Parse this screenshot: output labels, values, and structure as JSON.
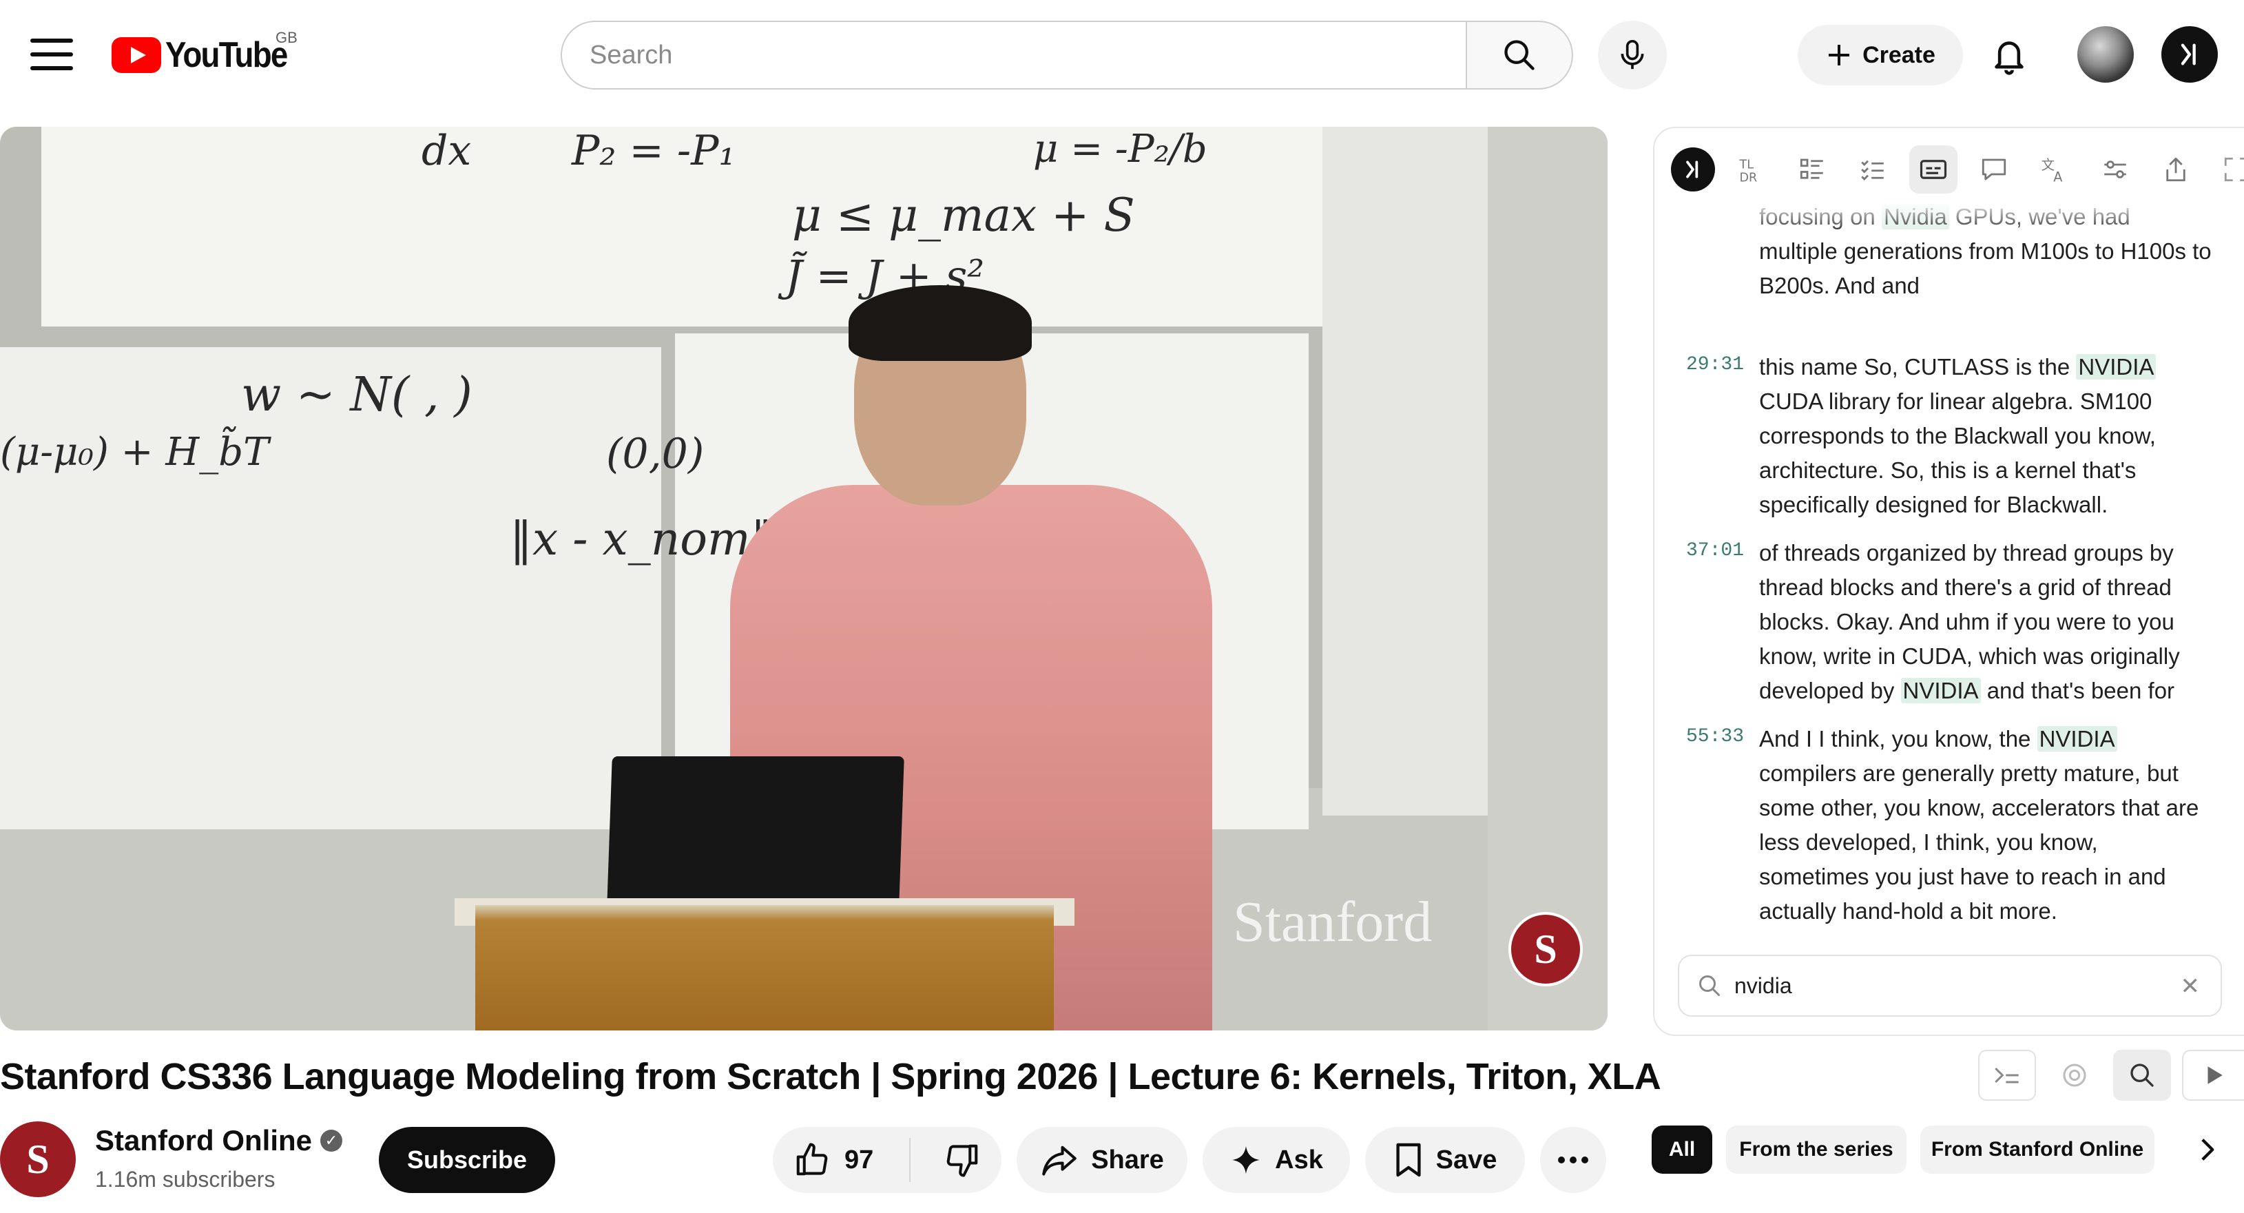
{
  "header": {
    "logo_text": "YouTube",
    "region": "GB",
    "search_placeholder": "Search",
    "create_label": "Create"
  },
  "video": {
    "watermark": "Stanford",
    "title": "Stanford CS336 Language Modeling from Scratch | Spring 2026 | Lecture 6: Kernels, Triton, XLA",
    "chalk": [
      "dx",
      "P₂ = -P₁",
      "μ = -P₂/b",
      "μ ≤ μ_max + S",
      "J̃ = J + s²",
      "w ~ N( , )",
      "(0,0)",
      "‖x - x_nom‖²",
      "(μ-μ₀) + H_b̃T"
    ]
  },
  "channel": {
    "name": "Stanford Online",
    "subscribers": "1.16m subscribers",
    "subscribe_label": "Subscribe"
  },
  "actions": {
    "likes": "97",
    "share_label": "Share",
    "ask_label": "Ask",
    "save_label": "Save"
  },
  "transcript": {
    "partial_top": "focusing on |Nvidia| GPUs, we've had multiple generations from M100s to H100s to B200s. And and",
    "segments": [
      {
        "time": "29:31",
        "pre": "this name So, CUTLASS is the ",
        "hit": "NVIDIA",
        "post": " CUDA library for linear algebra. SM100 corresponds to the Blackwall you know, architecture. So, this is a kernel that's specifically designed for Blackwall."
      },
      {
        "time": "37:01",
        "pre": "of threads organized by thread groups by thread blocks and there's a grid of thread blocks. Okay. And uhm if you were to you know, write in CUDA, which was originally developed by ",
        "hit": "NVIDIA",
        "post": " and that's been for"
      },
      {
        "time": "55:33",
        "pre": "And I I think, you know, the ",
        "hit": "NVIDIA",
        "post": " compilers are generally pretty mature, but some other, you know, accelerators that are less developed, I think, you know, sometimes you just have to reach in and actually hand-hold a bit more."
      }
    ],
    "search_value": "nvidia"
  },
  "chips": {
    "all": "All",
    "series": "From the series",
    "stanford": "From Stanford Online"
  },
  "colors": {
    "brand_red": "#ff0000",
    "stanford_red": "#9b1c22",
    "highlight": "#dff0e8",
    "timestamp": "#3a7a70"
  }
}
